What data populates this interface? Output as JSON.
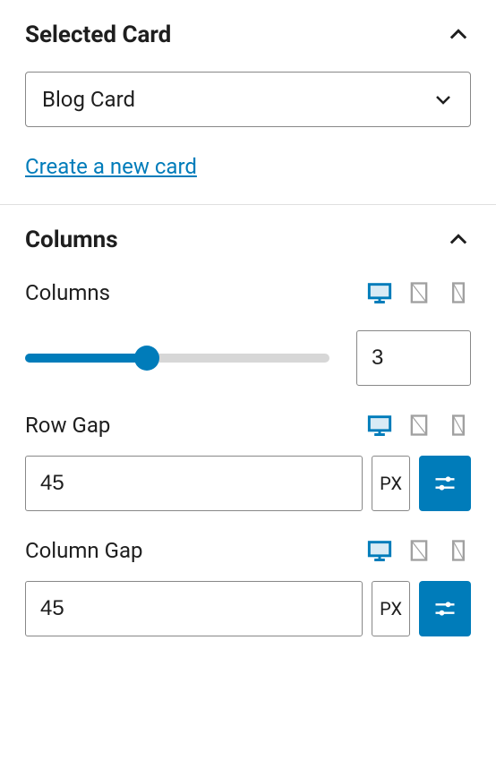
{
  "panels": {
    "selected_card": {
      "title": "Selected Card",
      "select_value": "Blog Card",
      "link_text": "Create a new card"
    },
    "columns": {
      "title": "Columns",
      "columns_field": {
        "label": "Columns",
        "value": "3",
        "slider_percent": 40
      },
      "row_gap": {
        "label": "Row Gap",
        "value": "45",
        "unit": "PX"
      },
      "column_gap": {
        "label": "Column Gap",
        "value": "45",
        "unit": "PX"
      }
    }
  }
}
